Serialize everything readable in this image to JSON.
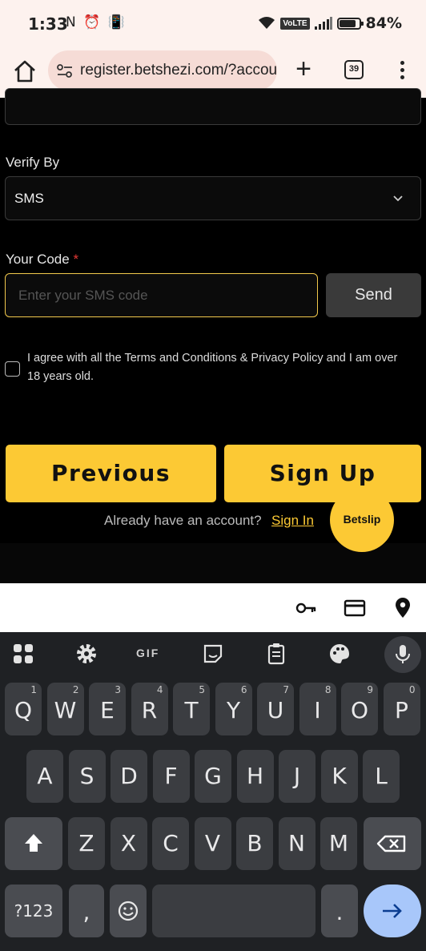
{
  "status_bar": {
    "time": "1:33",
    "left_icons": "N ⏰ 📳",
    "volte": "VoLTE",
    "battery_level": 0.84,
    "battery_pct": "84%"
  },
  "browser": {
    "url": "register.betshezi.com/?accour",
    "tab_count": "39",
    "new_tab_label": "+"
  },
  "form": {
    "verify_by_label": "Verify By",
    "verify_by_value": "SMS",
    "code_label": "Your Code",
    "required_mark": "*",
    "code_placeholder": "Enter your SMS code",
    "send_label": "Send",
    "agree_text": "I agree with all the Terms and Conditions & Privacy Policy and I am over 18 years old.",
    "previous_label": "Previous",
    "signup_label": "Sign Up",
    "already_text": "Already have an account?",
    "signin_label": "Sign In",
    "betslip_label": "Betslip"
  },
  "keyboard": {
    "toolbar": {
      "gif_label": "GIF"
    },
    "row1": [
      {
        "k": "Q",
        "h": "1"
      },
      {
        "k": "W",
        "h": "2"
      },
      {
        "k": "E",
        "h": "3"
      },
      {
        "k": "R",
        "h": "4"
      },
      {
        "k": "T",
        "h": "5"
      },
      {
        "k": "Y",
        "h": "6"
      },
      {
        "k": "U",
        "h": "7"
      },
      {
        "k": "I",
        "h": "8"
      },
      {
        "k": "O",
        "h": "9"
      },
      {
        "k": "P",
        "h": "0"
      }
    ],
    "row2": [
      "A",
      "S",
      "D",
      "F",
      "G",
      "H",
      "J",
      "K",
      "L"
    ],
    "row3": [
      "Z",
      "X",
      "C",
      "V",
      "B",
      "N",
      "M"
    ],
    "symbols_label": "?123",
    "comma_label": ",",
    "period_label": "."
  }
}
